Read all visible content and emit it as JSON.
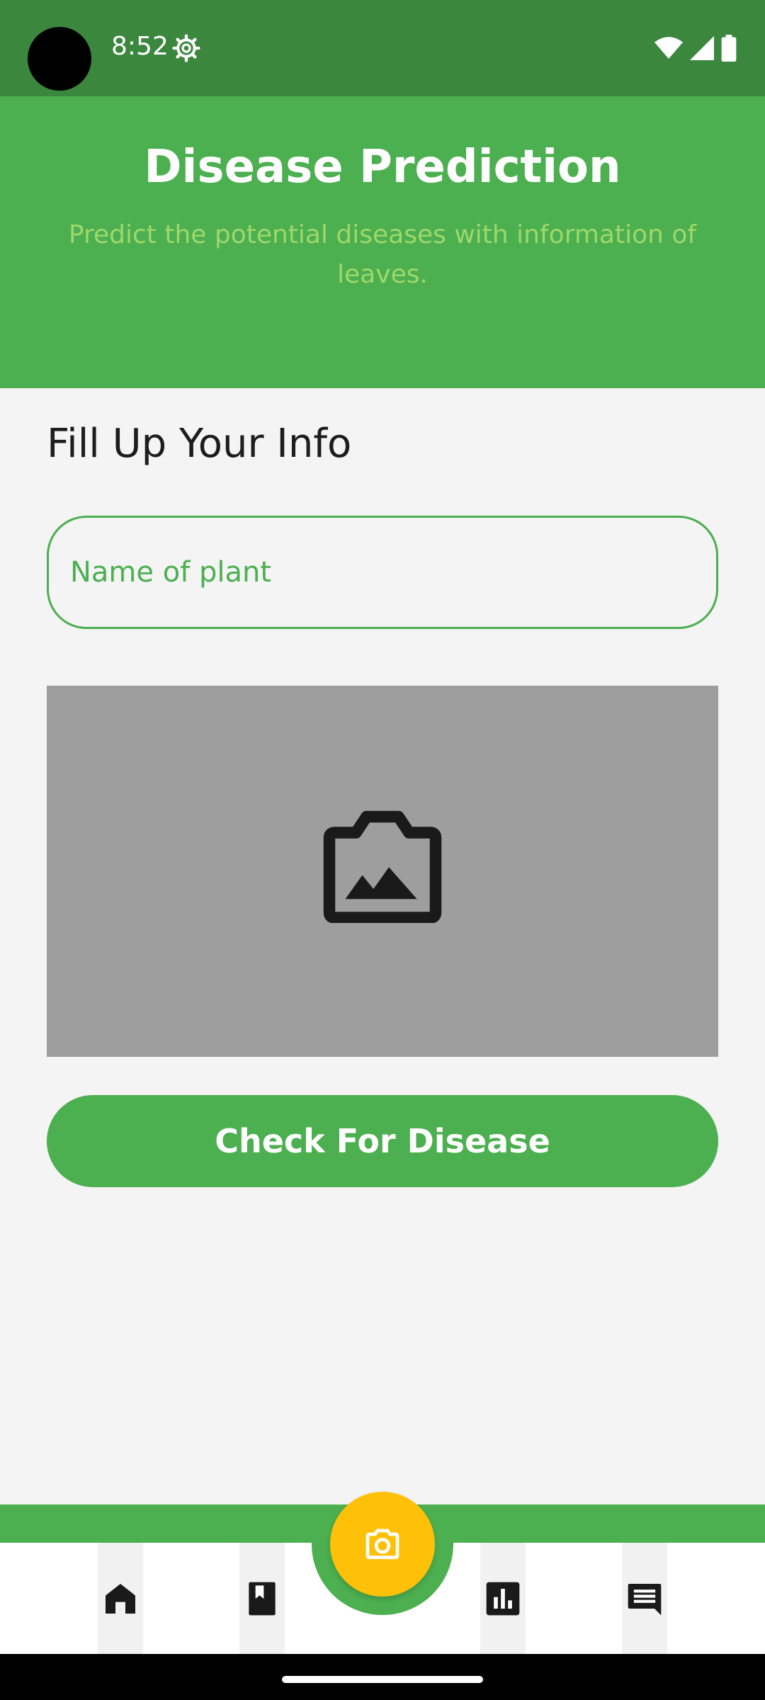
{
  "status_bar": {
    "time": "8:52",
    "icons": [
      "settings-gear-icon",
      "wifi-icon",
      "cellular-signal-icon",
      "battery-icon"
    ]
  },
  "header": {
    "title": "Disease Prediction",
    "subtitle": "Predict the potential diseases with information of leaves."
  },
  "form": {
    "section_title": "Fill Up Your Info",
    "plant_name_input": {
      "placeholder": "Name of plant",
      "value": ""
    },
    "image_picker_icon": "image-placeholder-icon",
    "submit_label": "Check For Disease"
  },
  "bottom_nav": {
    "items": [
      "home-icon",
      "book-icon",
      "camera-icon",
      "chart-icon",
      "chat-icon"
    ],
    "fab_color": "#ffc107"
  },
  "colors": {
    "status_bar": "#3b873e",
    "primary": "#4caf50",
    "subtitle": "#9ed86b",
    "image_area": "#9e9e9e",
    "background": "#f4f4f4"
  }
}
